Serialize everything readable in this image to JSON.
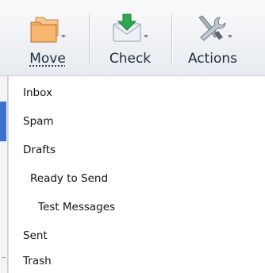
{
  "toolbar": {
    "buttons": [
      {
        "label": "Move",
        "icon": "folders-move-icon"
      },
      {
        "label": "Check",
        "icon": "mail-check-icon"
      },
      {
        "label": "Actions",
        "icon": "tools-icon"
      }
    ]
  },
  "folders": [
    {
      "label": "Inbox",
      "level": 0
    },
    {
      "label": "Spam",
      "level": 0
    },
    {
      "label": "Drafts",
      "level": 0
    },
    {
      "label": "Ready to Send",
      "level": 1
    },
    {
      "label": "Test Messages",
      "level": 2
    },
    {
      "label": "Sent",
      "level": 0
    },
    {
      "label": "Trash",
      "level": 0
    }
  ],
  "colors": {
    "accent": "#3b6fd1",
    "folder_orange": "#f2a65a",
    "envelope_green": "#2fa84f"
  }
}
